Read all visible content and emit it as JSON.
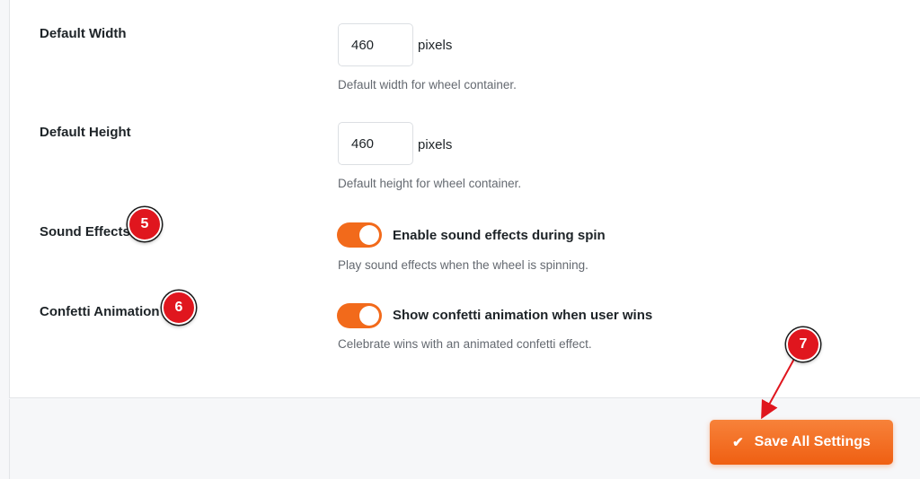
{
  "settings": {
    "default_width": {
      "label": "Default Width",
      "value": "460",
      "unit": "pixels",
      "help": "Default width for wheel container."
    },
    "default_height": {
      "label": "Default Height",
      "value": "460",
      "unit": "pixels",
      "help": "Default height for wheel container."
    },
    "sound_effects": {
      "label": "Sound Effects",
      "toggle_label": "Enable sound effects during spin",
      "help": "Play sound effects when the wheel is spinning.",
      "enabled": true
    },
    "confetti_animation": {
      "label": "Confetti Animation",
      "toggle_label": "Show confetti animation when user wins",
      "help": "Celebrate wins with an animated confetti effect.",
      "enabled": true
    }
  },
  "annotations": {
    "badge_5": "5",
    "badge_6": "6",
    "badge_7": "7"
  },
  "footer": {
    "save_label": "Save All Settings",
    "save_icon": "check-icon"
  },
  "colors": {
    "accent": "#f26a1b",
    "badge": "#e0161e"
  }
}
